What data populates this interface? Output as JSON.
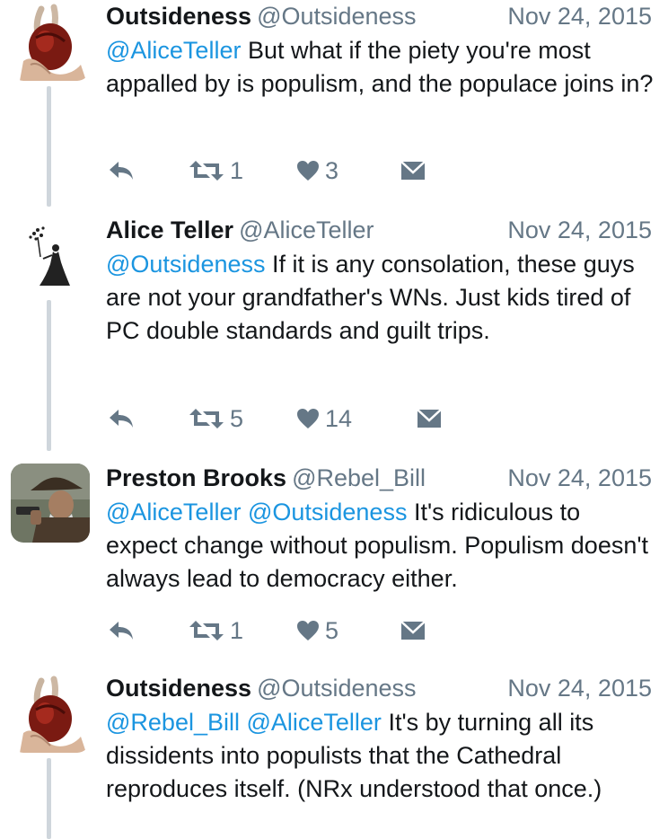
{
  "tweets": [
    {
      "name": "Outsideness",
      "handle": "@Outsideness",
      "date": "Nov 24, 2015",
      "mentions": "@AliceTeller",
      "text": " But what if the piety you're most appalled by is populism, and the populace joins in?",
      "retweets": "1",
      "likes": "3",
      "avatar_icon": "anatomical-heart-in-hand"
    },
    {
      "name": "Alice Teller",
      "handle": "@AliceTeller",
      "date": "Nov 24, 2015",
      "mentions": "@Outsideness",
      "text": " If it is any consolation, these guys are not your grandfather's WNs. Just kids tired of PC double standards and guilt trips.",
      "retweets": "5",
      "likes": "14",
      "avatar_icon": "silhouette-woman-tree"
    },
    {
      "name": "Preston Brooks",
      "handle": "@Rebel_Bill",
      "date": "Nov 24, 2015",
      "mentions": "@AliceTeller @Outsideness",
      "text": " It's ridiculous to expect change without populism.  Populism doesn't always lead to democracy either.",
      "retweets": "1",
      "likes": "5",
      "avatar_icon": "cowboy-with-revolver"
    },
    {
      "name": "Outsideness",
      "handle": "@Outsideness",
      "date": "Nov 24, 2015",
      "mentions": "@Rebel_Bill @AliceTeller",
      "text": " It's by turning all its dissidents into populists that the Cathedral reproduces itself. (NRx understood that once.)",
      "avatar_icon": "anatomical-heart-in-hand"
    }
  ],
  "colors": {
    "link": "#1b95e0",
    "meta": "#657786",
    "text": "#14171a",
    "thread": "#cfd6dc"
  }
}
